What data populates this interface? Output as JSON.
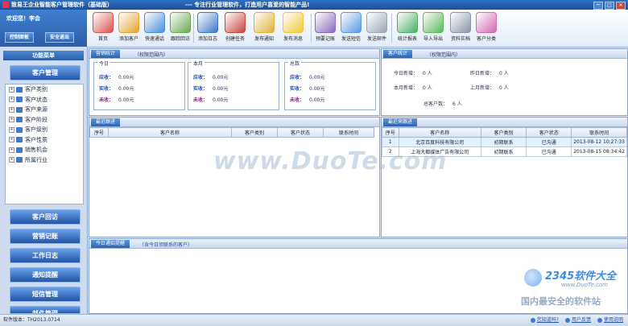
{
  "window": {
    "title": "致易王企业智能客户管理软件（基础版）",
    "slogan": "--- 专注行业管理软件，打造用户喜爱的智能产品!",
    "controls": [
      "－",
      "□",
      "×"
    ]
  },
  "user": {
    "welcome": "欢迎您！李会",
    "control_panel": "控制面板",
    "safe_exit": "安全退出"
  },
  "toolbar": [
    {
      "label": "首页",
      "icon": "home-icon",
      "color": "#d9534f"
    },
    {
      "label": "添加客户",
      "icon": "add-customer-icon",
      "color": "#e4a532"
    },
    {
      "label": "快速通话",
      "icon": "quick-call-icon",
      "color": "#4a8fd8"
    },
    {
      "label": "跟踪回访",
      "icon": "follow-up-icon",
      "color": "#6aa84f"
    },
    {
      "label": "添加日志",
      "icon": "add-log-icon",
      "color": "#3d78c9"
    },
    {
      "label": "创建任务",
      "icon": "calendar-icon",
      "color": "#c9463d"
    },
    {
      "label": "发布通知",
      "icon": "alarm-clock-icon",
      "color": "#e0b23a"
    },
    {
      "label": "发布消息",
      "icon": "message-bubble-icon",
      "color": "#f0c83a"
    },
    {
      "label": "预要记账",
      "icon": "notebook-icon",
      "color": "#8a6bbf"
    },
    {
      "label": "发送短信",
      "icon": "sms-phone-icon",
      "color": "#5a9be3"
    },
    {
      "label": "发送邮件",
      "icon": "mail-icon",
      "color": "#9aa7b8"
    },
    {
      "label": "统计报表",
      "icon": "report-chart-icon",
      "color": "#4caf6a"
    },
    {
      "label": "导入导出",
      "icon": "import-export-icon",
      "color": "#5cb85c"
    },
    {
      "label": "资料实档",
      "icon": "database-icon",
      "color": "#8896a8"
    },
    {
      "label": "客户分类",
      "icon": "magic-wand-icon",
      "color": "#d46ab0"
    }
  ],
  "sidebar": {
    "menu_title": "功能菜单",
    "top_button": "客户管理",
    "tree": [
      "客户类别",
      "客户状态",
      "客户来源",
      "客户阶段",
      "客户级别",
      "客户性质",
      "销售机会",
      "所属行业"
    ],
    "bottom_buttons": [
      "客户回访",
      "营销记账",
      "工作日志",
      "通知提醒",
      "短信管理",
      "邮件管理"
    ]
  },
  "sales_panel": {
    "tab": "营销统计",
    "scope": "（权限范围内）",
    "columns": [
      {
        "title": "今日",
        "receivable": "0.00元",
        "received": "0.00元",
        "unpaid": "0.00元"
      },
      {
        "title": "本月",
        "receivable": "0.00元",
        "received": "0.00元",
        "unpaid": "0.00元"
      },
      {
        "title": "总数",
        "receivable": "0.00元",
        "received": "0.00元",
        "unpaid": "0.00元"
      }
    ],
    "labels": {
      "receivable": "应收：",
      "received": "实收：",
      "unpaid": "未收："
    }
  },
  "customer_stats": {
    "tab": "客户统计",
    "scope": "（权限范围内）",
    "today_new_label": "今日新增：",
    "today_new": "0 人",
    "yesterday_new_label": "昨日新增：",
    "yesterday_new": "0 人",
    "month_new_label": "本月新增：",
    "month_new": "0 人",
    "last_month_new_label": "上月新增：",
    "last_month_new": "0 人",
    "total_label": "总客户数：",
    "total": "6 人"
  },
  "recent_followup": {
    "tab": "最近跟进",
    "headers": [
      "序号",
      "客户名称",
      "客户类别",
      "客户状态",
      "联系时间"
    ],
    "rows": []
  },
  "recent_contacts": {
    "tab": "最近来跟进",
    "headers": [
      "序号",
      "客户名称",
      "客户类别",
      "客户状态",
      "联系时间"
    ],
    "rows": [
      {
        "no": "1",
        "name": "北京百度科技有限公司",
        "type": "初期联系",
        "status": "已沟通",
        "time": "2013-08-12 10:27:33"
      },
      {
        "no": "2",
        "name": "上海大都媒体广告有限公司",
        "type": "初期联系",
        "status": "已沟通",
        "time": "2013-08-15 08:34:42"
      }
    ]
  },
  "reminder": {
    "tab": "今日通知提醒",
    "note": "（含今日须联系的客户）"
  },
  "status": {
    "version": "软件版本：TH2013.0714",
    "links": [
      "您知道吗?",
      "用户反馈",
      "使用说明"
    ]
  },
  "watermark": {
    "main": "www.DuoTe.com",
    "brand": "2345软件大全",
    "brand_url": "www.DuoTe.com",
    "caption": "国内最安全的软件站"
  }
}
